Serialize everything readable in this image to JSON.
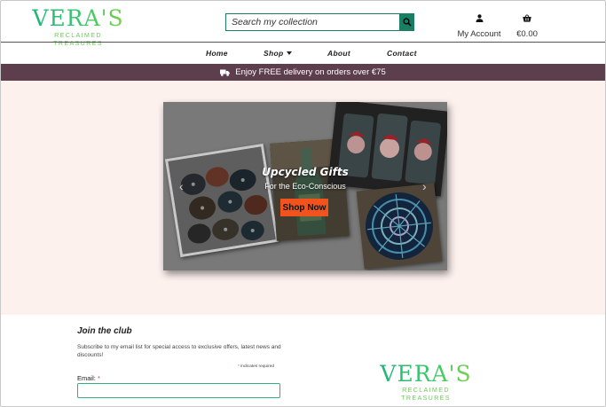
{
  "header": {
    "logo_name": "VERA'S",
    "logo_tagline": "RECLAIMED TREASURES",
    "search_placeholder": "Search my collection",
    "account_label": "My Account",
    "cart_total": "€0.00"
  },
  "nav": {
    "items": [
      {
        "label": "Home"
      },
      {
        "label": "Shop"
      },
      {
        "label": "About"
      },
      {
        "label": "Contact"
      }
    ]
  },
  "banner": {
    "text": "Enjoy FREE delivery on orders over €75",
    "icon": "truck-icon"
  },
  "hero": {
    "title": "Upcycled Gifts",
    "subtitle": "For the Eco-Conscious",
    "cta_label": "Shop Now",
    "cta_color": "#f2531c",
    "prev_icon": "chevron-left-icon",
    "next_icon": "chevron-right-icon"
  },
  "newsletter": {
    "title": "Join the club",
    "description": "Subscribe to my email list for special access to exclusive offers, latest news and discounts!",
    "required_note": "indicates required",
    "email_label": "Email:",
    "required_mark": "*"
  },
  "footer": {
    "logo_name": "VERA'S",
    "logo_tagline": "RECLAIMED TREASURES"
  },
  "colors": {
    "brand_green": "#1a7e63",
    "banner_bg": "#5c3e4c",
    "hero_bg": "#fdf1ee",
    "cta": "#f2531c"
  }
}
